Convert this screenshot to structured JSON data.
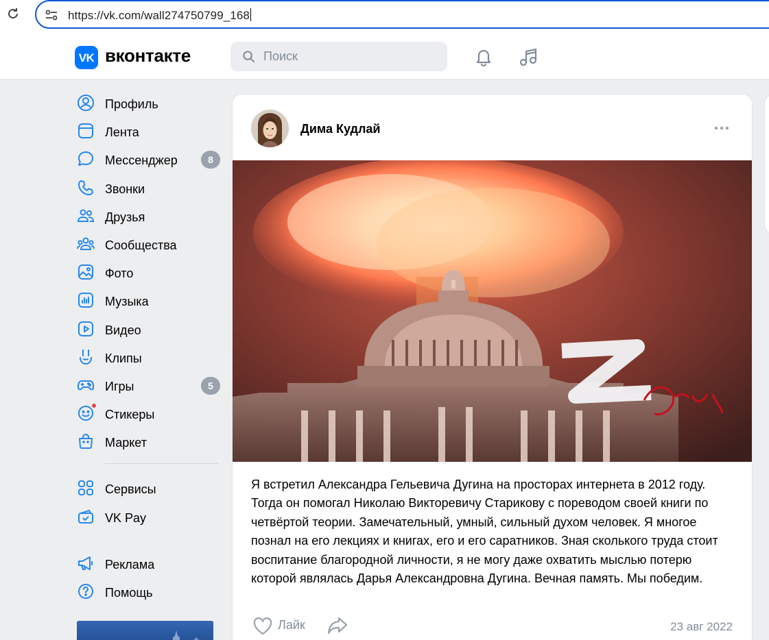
{
  "browser": {
    "url": "https://vk.com/wall274750799_168"
  },
  "header": {
    "logo_text": "VK",
    "wordmark": "вконтакте",
    "search_placeholder": "Поиск"
  },
  "sidebar": {
    "items": [
      {
        "label": "Профиль",
        "icon": "profile-icon"
      },
      {
        "label": "Лента",
        "icon": "feed-icon"
      },
      {
        "label": "Мессенджер",
        "icon": "messenger-icon",
        "badge": "8"
      },
      {
        "label": "Звонки",
        "icon": "phone-icon"
      },
      {
        "label": "Друзья",
        "icon": "friends-icon"
      },
      {
        "label": "Сообщества",
        "icon": "communities-icon"
      },
      {
        "label": "Фото",
        "icon": "photo-icon"
      },
      {
        "label": "Музыка",
        "icon": "music-icon"
      },
      {
        "label": "Видео",
        "icon": "video-icon"
      },
      {
        "label": "Клипы",
        "icon": "clips-icon"
      },
      {
        "label": "Игры",
        "icon": "games-icon",
        "badge": "5"
      },
      {
        "label": "Стикеры",
        "icon": "stickers-icon"
      },
      {
        "label": "Маркет",
        "icon": "market-icon"
      }
    ],
    "services": [
      {
        "label": "Сервисы",
        "icon": "services-icon"
      },
      {
        "label": "VK Pay",
        "icon": "vkpay-icon"
      }
    ],
    "footer": [
      {
        "label": "Реклама",
        "icon": "ads-icon"
      },
      {
        "label": "Помощь",
        "icon": "help-icon"
      }
    ]
  },
  "post": {
    "author": "Дима Кудлай",
    "image_caption_text": "Za Дашу",
    "text": "Я встретил Александра Гельевича Дугина на просторах интернета в 2012 году. Тогда он помогал Николаю Викторевичу Старикову с пореводом своей книги по четвёртой теории. Замечательный, умный, сильный духом человек. Я многое познал на его лекциях и книгах, его и его саратников. Зная сколького труда стоит воспитание благородной личности, я не могу даже охватить мыслью потерю которой являлась Дарья Александровна Дугина. Вечная память. Мы победим.",
    "like_label": "Лайк",
    "date": "23 авг 2022"
  },
  "colors": {
    "accent": "#2688eb",
    "brand": "#0077ff",
    "page_bg": "#edeef0",
    "badge_bg": "#99a2ad",
    "secondary_text": "#818c99"
  }
}
